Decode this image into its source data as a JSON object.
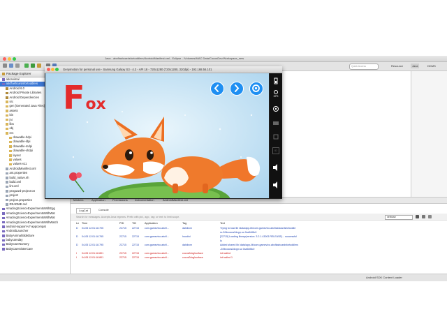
{
  "window": {
    "title": "Java - abcflashcardsfortoddlers/AndroidManifest.xml - Eclipse - /Volumes/MAC Data/CocosDev/Workspace_new"
  },
  "toolbar": {
    "quick_access_placeholder": "Quick Access",
    "perspectives": [
      "Resource",
      "Java",
      "DDMS"
    ]
  },
  "package_explorer": {
    "title": "Package Explorer",
    "items": [
      {
        "label": "abcanimal",
        "indent": 0,
        "type": "project"
      },
      {
        "label": "abcflashcardsfortoddlers",
        "indent": 0,
        "type": "project",
        "selected": true
      },
      {
        "label": "Android 6.0",
        "indent": 1,
        "type": "lib"
      },
      {
        "label": "Android Private Libraries",
        "indent": 1,
        "type": "lib"
      },
      {
        "label": "Android Dependencies",
        "indent": 1,
        "type": "lib"
      },
      {
        "label": "src",
        "indent": 1,
        "type": "folder"
      },
      {
        "label": "gen [Generated Java Files]",
        "indent": 1,
        "type": "folder"
      },
      {
        "label": "assets",
        "indent": 1,
        "type": "folder"
      },
      {
        "label": "bin",
        "indent": 1,
        "type": "folder"
      },
      {
        "label": "jni",
        "indent": 1,
        "type": "folder"
      },
      {
        "label": "libs",
        "indent": 1,
        "type": "folder"
      },
      {
        "label": "obj",
        "indent": 1,
        "type": "folder"
      },
      {
        "label": "res",
        "indent": 1,
        "type": "folder"
      },
      {
        "label": "drawable-hdpi",
        "indent": 2,
        "type": "folder"
      },
      {
        "label": "drawable-ldpi",
        "indent": 2,
        "type": "folder"
      },
      {
        "label": "drawable-mdpi",
        "indent": 2,
        "type": "folder"
      },
      {
        "label": "drawable-xhdpi",
        "indent": 2,
        "type": "folder"
      },
      {
        "label": "layout",
        "indent": 2,
        "type": "folder"
      },
      {
        "label": "values",
        "indent": 2,
        "type": "folder"
      },
      {
        "label": "values-v11",
        "indent": 2,
        "type": "folder"
      },
      {
        "label": "AndroidManifest.xml",
        "indent": 1,
        "type": "file"
      },
      {
        "label": "ant.properties",
        "indent": 1,
        "type": "file"
      },
      {
        "label": "build_native.sh",
        "indent": 1,
        "type": "file"
      },
      {
        "label": "build.xml",
        "indent": 1,
        "type": "file"
      },
      {
        "label": "lint.xml",
        "indent": 1,
        "type": "file"
      },
      {
        "label": "proguard-project.txt",
        "indent": 1,
        "type": "file"
      },
      {
        "label": "project",
        "indent": 1,
        "type": "file"
      },
      {
        "label": "project.properties",
        "indent": 1,
        "type": "file"
      },
      {
        "label": "README.md",
        "indent": 1,
        "type": "file"
      },
      {
        "label": "AmazingScienceExperimentsWithEgg",
        "indent": 0,
        "type": "project"
      },
      {
        "label": "AmazingScienceExperimentsWithWat",
        "indent": 0,
        "type": "project"
      },
      {
        "label": "AmazingScienceExperimentsWithWat",
        "indent": 0,
        "type": "project"
      },
      {
        "label": "AmazingScienceExperimentsWithWatch",
        "indent": 0,
        "type": "project"
      },
      {
        "label": "android-support-v7-appcompat",
        "indent": 0,
        "type": "project"
      },
      {
        "label": "AndroidLauncher",
        "indent": 0,
        "type": "project"
      },
      {
        "label": "BabyAnimalSlideDare",
        "indent": 0,
        "type": "project"
      },
      {
        "label": "babycareday",
        "indent": 0,
        "type": "project"
      },
      {
        "label": "BabyCareNursery",
        "indent": 0,
        "type": "project"
      },
      {
        "label": "BabyCareSisterCare",
        "indent": 0,
        "type": "project"
      }
    ]
  },
  "emulator": {
    "title": "Genymotion for personal use - Samsung Galaxy S3 - 4.3 - API 18 - 720x1280 (720x1280, 320dpi) - 192.168.56.101",
    "app_title_first": "F",
    "app_title_rest": "ox",
    "sidebar_labels": {
      "battery": "",
      "gps": "GPS",
      "camera": "",
      "id": "ID"
    }
  },
  "bottom_tabs": [
    "Markers",
    "Properties",
    "Servers",
    "Data Source Explorer",
    "Snippets",
    "Console",
    "Progress",
    "LogCat"
  ],
  "bottom_tabs_visible": [
    "Markers",
    "Application",
    "Permissions",
    "Instrumentation",
    "AndroidManifest.xml"
  ],
  "logcat": {
    "tab_label": "LogCat",
    "console_label": "Console",
    "search_placeholder": "Search for messages. Accepts Java regexes. Prefix with pid:, app:, tag: or text: to limit scope.",
    "level": "verbose",
    "columns": [
      "Le",
      "Time",
      "PID",
      "TID",
      "Application",
      "Tag",
      "Text"
    ],
    "rows": [
      {
        "level": "D",
        "time": "04-05 12:01:18.705",
        "pid": "22715",
        "tid": "22715",
        "app": "com.gamevivo.abcfl...",
        "tag": "dalvikvm",
        "text": "Trying to load lib /data/app-lib/com.gamevivo.abcflashcardsfortoddle",
        "color": "#1a3fb0"
      },
      {
        "level": "",
        "time": "",
        "pid": "",
        "tid": "",
        "app": "",
        "tag": "",
        "text": "rs-2/libcocos2dcpp.so 0xa54f8c0",
        "color": "#1a3fb0"
      },
      {
        "level": "D",
        "time": "04-05 12:01:18.765",
        "pid": "22715",
        "tid": "22715",
        "app": "com.gamevivo.abcfl...",
        "tag": "houdini",
        "text": "[22715] Loading library(version: 3.2.1.43003 RELEASE)... successful",
        "color": "#1a3fb0"
      },
      {
        "level": "",
        "time": "",
        "pid": "",
        "tid": "",
        "app": "",
        "tag": "",
        "text": "ly.",
        "color": "#1a3fb0"
      },
      {
        "level": "D",
        "time": "04-05 12:01:18.795",
        "pid": "22715",
        "tid": "22715",
        "app": "com.gamevivo.abcfl...",
        "tag": "dalvikvm",
        "text": "Added shared lib /data/app-lib/com.gamevivo.abcflashcardsfortoddlers",
        "color": "#1a3fb0"
      },
      {
        "level": "",
        "time": "",
        "pid": "",
        "tid": "",
        "app": "",
        "tag": "",
        "text": "-2/libcocos2dcpp.so 0xa54f8c0",
        "color": "#1a3fb0"
      },
      {
        "level": "I",
        "time": "04-05 12:01:18.801",
        "pid": "22715",
        "tid": "22715",
        "app": "com.gamevivo.abcfl...",
        "tag": "cocos2dxglsurface",
        "text": "init called",
        "color": "#cc1111"
      },
      {
        "level": "I",
        "time": "04-05 12:01:18.801",
        "pid": "22715",
        "tid": "22715",
        "app": "com.gamevivo.abcfl...",
        "tag": "cocos2dxglsurface",
        "text": "init called 1",
        "color": "#cc1111"
      }
    ]
  },
  "status": {
    "text": "Android SDK Content Loader"
  }
}
